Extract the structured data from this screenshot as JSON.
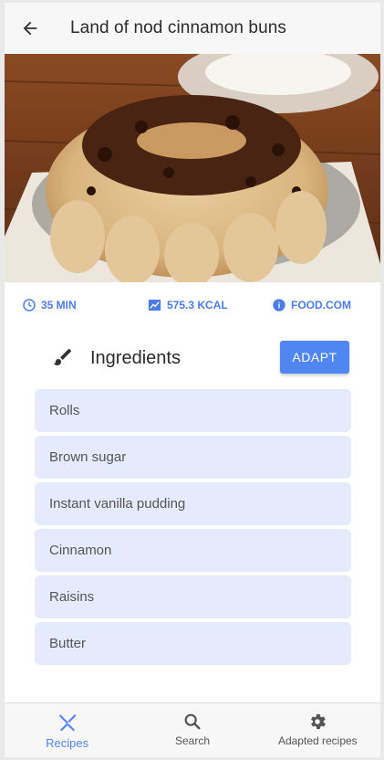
{
  "appbar": {
    "title": "Land of nod cinnamon buns",
    "back_icon": "arrow-back-icon"
  },
  "hero": {
    "icon": "recipe-photo"
  },
  "meta": {
    "time": {
      "label": "35 MIN",
      "icon": "clock-icon"
    },
    "calories": {
      "label": "575.3 KCAL",
      "icon": "trend-chart-icon"
    },
    "source": {
      "label": "FOOD.COM",
      "icon": "info-icon"
    },
    "accent_color": "#4a7ee6"
  },
  "ingredients": {
    "title": "Ingredients",
    "icon": "brush-icon",
    "adapt_label": "ADAPT",
    "items": [
      "Rolls",
      "Brown sugar",
      "Instant vanilla pudding",
      "Cinnamon",
      "Raisins",
      "Butter"
    ]
  },
  "bottom_nav": {
    "items": [
      {
        "label": "Recipes",
        "icon": "fork-knife-icon",
        "active": true
      },
      {
        "label": "Search",
        "icon": "search-icon",
        "active": false
      },
      {
        "label": "Adapted recipes",
        "icon": "gear-icon",
        "active": false
      }
    ],
    "active_color": "#4f86f2"
  }
}
